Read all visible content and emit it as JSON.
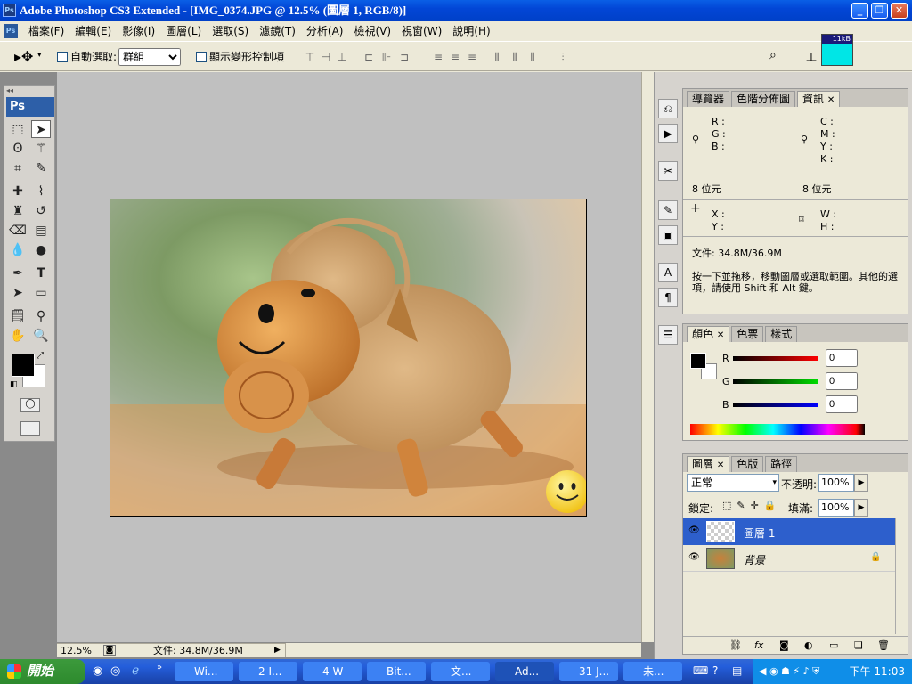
{
  "window": {
    "title": "Adobe Photoshop CS3 Extended - [IMG_0374.JPG @ 12.5% (圖層 1, RGB/8)]",
    "app_icon": "Ps"
  },
  "menu": [
    "檔案(F)",
    "編輯(E)",
    "影像(I)",
    "圖層(L)",
    "選取(S)",
    "濾鏡(T)",
    "分析(A)",
    "檢視(V)",
    "視窗(W)",
    "說明(H)"
  ],
  "options": {
    "auto_select_label": "自動選取:",
    "auto_select_value": "群組",
    "show_transform_label": "顯示變形控制項",
    "workspace_label": "工",
    "kb_label": "11kB"
  },
  "toolbox": {
    "logo": "Ps"
  },
  "status": {
    "zoom": "12.5%",
    "doc": "文件: 34.8M/36.9M"
  },
  "info_panel": {
    "tabs": [
      "導覽器",
      "色階分佈圖",
      "資訊"
    ],
    "rgb_labels": [
      "R :",
      "G :",
      "B :"
    ],
    "cmyk_labels": [
      "C :",
      "M :",
      "Y :",
      "K :"
    ],
    "bits_left": "8 位元",
    "bits_right": "8 位元",
    "xy_labels": [
      "X :",
      "Y :"
    ],
    "wh_labels": [
      "W :",
      "H :"
    ],
    "doc": "文件: 34.8M/36.9M",
    "hint": "按一下並拖移，移動圖層或選取範圍。其他的選項，請使用 Shift 和 Alt 鍵。"
  },
  "color_panel": {
    "tabs": [
      "顏色",
      "色票",
      "樣式"
    ],
    "r_label": "R",
    "g_label": "G",
    "b_label": "B",
    "r": "0",
    "g": "0",
    "b": "0"
  },
  "layers_panel": {
    "tabs": [
      "圖層",
      "色版",
      "路徑"
    ],
    "blend": "正常",
    "opacity_label": "不透明:",
    "opacity": "100%",
    "lock_label": "鎖定:",
    "fill_label": "填滿:",
    "fill": "100%",
    "layers": [
      {
        "name": "圖層 1"
      },
      {
        "name": "背景"
      }
    ]
  },
  "taskbar": {
    "start": "開始",
    "tasks": [
      "Wi...",
      "2 I...",
      "4 W",
      "Bit...",
      "文...",
      "Ad...",
      "31 J...",
      "未..."
    ],
    "clock": "下午 11:03"
  },
  "colors": {
    "title_blue": "#0246d6",
    "selected_layer": "#2d5fcc",
    "fg_color": "#000000"
  }
}
